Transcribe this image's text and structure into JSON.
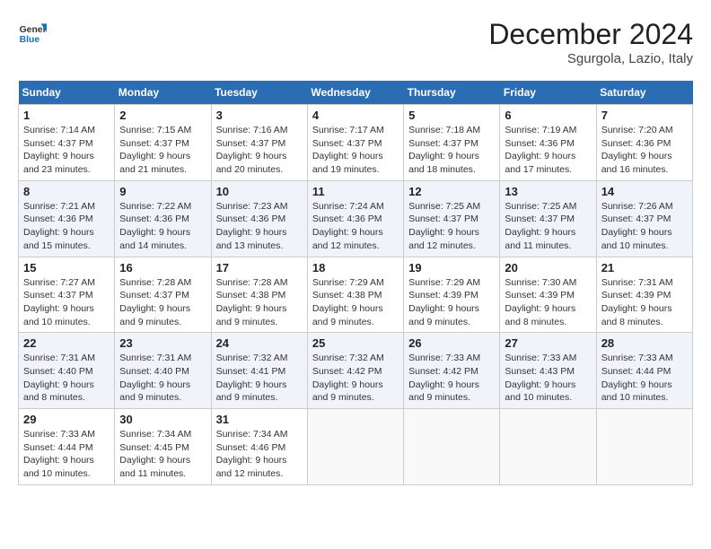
{
  "header": {
    "logo_general": "General",
    "logo_blue": "Blue",
    "month_title": "December 2024",
    "location": "Sgurgola, Lazio, Italy"
  },
  "weekdays": [
    "Sunday",
    "Monday",
    "Tuesday",
    "Wednesday",
    "Thursday",
    "Friday",
    "Saturday"
  ],
  "weeks": [
    [
      {
        "day": "1",
        "sunrise": "7:14 AM",
        "sunset": "4:37 PM",
        "daylight": "9 hours and 23 minutes."
      },
      {
        "day": "2",
        "sunrise": "7:15 AM",
        "sunset": "4:37 PM",
        "daylight": "9 hours and 21 minutes."
      },
      {
        "day": "3",
        "sunrise": "7:16 AM",
        "sunset": "4:37 PM",
        "daylight": "9 hours and 20 minutes."
      },
      {
        "day": "4",
        "sunrise": "7:17 AM",
        "sunset": "4:37 PM",
        "daylight": "9 hours and 19 minutes."
      },
      {
        "day": "5",
        "sunrise": "7:18 AM",
        "sunset": "4:37 PM",
        "daylight": "9 hours and 18 minutes."
      },
      {
        "day": "6",
        "sunrise": "7:19 AM",
        "sunset": "4:36 PM",
        "daylight": "9 hours and 17 minutes."
      },
      {
        "day": "7",
        "sunrise": "7:20 AM",
        "sunset": "4:36 PM",
        "daylight": "9 hours and 16 minutes."
      }
    ],
    [
      {
        "day": "8",
        "sunrise": "7:21 AM",
        "sunset": "4:36 PM",
        "daylight": "9 hours and 15 minutes."
      },
      {
        "day": "9",
        "sunrise": "7:22 AM",
        "sunset": "4:36 PM",
        "daylight": "9 hours and 14 minutes."
      },
      {
        "day": "10",
        "sunrise": "7:23 AM",
        "sunset": "4:36 PM",
        "daylight": "9 hours and 13 minutes."
      },
      {
        "day": "11",
        "sunrise": "7:24 AM",
        "sunset": "4:36 PM",
        "daylight": "9 hours and 12 minutes."
      },
      {
        "day": "12",
        "sunrise": "7:25 AM",
        "sunset": "4:37 PM",
        "daylight": "9 hours and 12 minutes."
      },
      {
        "day": "13",
        "sunrise": "7:25 AM",
        "sunset": "4:37 PM",
        "daylight": "9 hours and 11 minutes."
      },
      {
        "day": "14",
        "sunrise": "7:26 AM",
        "sunset": "4:37 PM",
        "daylight": "9 hours and 10 minutes."
      }
    ],
    [
      {
        "day": "15",
        "sunrise": "7:27 AM",
        "sunset": "4:37 PM",
        "daylight": "9 hours and 10 minutes."
      },
      {
        "day": "16",
        "sunrise": "7:28 AM",
        "sunset": "4:37 PM",
        "daylight": "9 hours and 9 minutes."
      },
      {
        "day": "17",
        "sunrise": "7:28 AM",
        "sunset": "4:38 PM",
        "daylight": "9 hours and 9 minutes."
      },
      {
        "day": "18",
        "sunrise": "7:29 AM",
        "sunset": "4:38 PM",
        "daylight": "9 hours and 9 minutes."
      },
      {
        "day": "19",
        "sunrise": "7:29 AM",
        "sunset": "4:39 PM",
        "daylight": "9 hours and 9 minutes."
      },
      {
        "day": "20",
        "sunrise": "7:30 AM",
        "sunset": "4:39 PM",
        "daylight": "9 hours and 8 minutes."
      },
      {
        "day": "21",
        "sunrise": "7:31 AM",
        "sunset": "4:39 PM",
        "daylight": "9 hours and 8 minutes."
      }
    ],
    [
      {
        "day": "22",
        "sunrise": "7:31 AM",
        "sunset": "4:40 PM",
        "daylight": "9 hours and 8 minutes."
      },
      {
        "day": "23",
        "sunrise": "7:31 AM",
        "sunset": "4:40 PM",
        "daylight": "9 hours and 9 minutes."
      },
      {
        "day": "24",
        "sunrise": "7:32 AM",
        "sunset": "4:41 PM",
        "daylight": "9 hours and 9 minutes."
      },
      {
        "day": "25",
        "sunrise": "7:32 AM",
        "sunset": "4:42 PM",
        "daylight": "9 hours and 9 minutes."
      },
      {
        "day": "26",
        "sunrise": "7:33 AM",
        "sunset": "4:42 PM",
        "daylight": "9 hours and 9 minutes."
      },
      {
        "day": "27",
        "sunrise": "7:33 AM",
        "sunset": "4:43 PM",
        "daylight": "9 hours and 10 minutes."
      },
      {
        "day": "28",
        "sunrise": "7:33 AM",
        "sunset": "4:44 PM",
        "daylight": "9 hours and 10 minutes."
      }
    ],
    [
      {
        "day": "29",
        "sunrise": "7:33 AM",
        "sunset": "4:44 PM",
        "daylight": "9 hours and 10 minutes."
      },
      {
        "day": "30",
        "sunrise": "7:34 AM",
        "sunset": "4:45 PM",
        "daylight": "9 hours and 11 minutes."
      },
      {
        "day": "31",
        "sunrise": "7:34 AM",
        "sunset": "4:46 PM",
        "daylight": "9 hours and 12 minutes."
      },
      null,
      null,
      null,
      null
    ]
  ],
  "labels": {
    "sunrise": "Sunrise:",
    "sunset": "Sunset:",
    "daylight": "Daylight:"
  }
}
